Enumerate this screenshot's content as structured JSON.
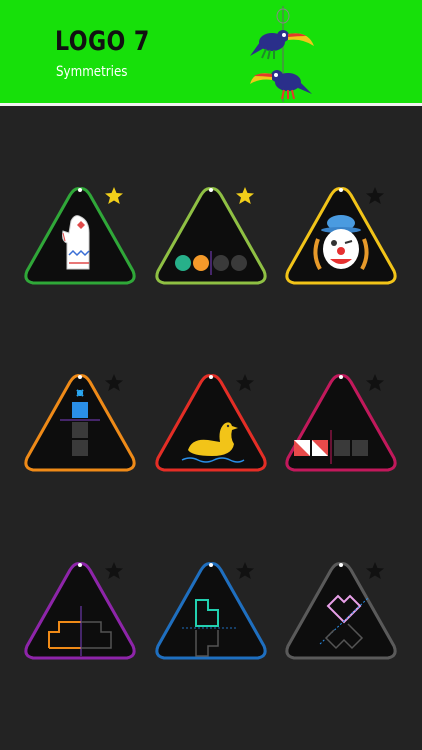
{
  "header": {
    "title": "LOGO 7",
    "subtitle": "Symmetries",
    "background_color": "#17e00a",
    "mascot_icon": "toucans-icon"
  },
  "levels": [
    {
      "name": "mitten",
      "color": "#2fa838",
      "starred": true
    },
    {
      "name": "dots",
      "color": "#8fc043",
      "starred": true
    },
    {
      "name": "clown",
      "color": "#f2c418",
      "starred": false
    },
    {
      "name": "stack",
      "color": "#ef8a17",
      "starred": false
    },
    {
      "name": "duck",
      "color": "#e52d25",
      "starred": false
    },
    {
      "name": "squares",
      "color": "#c2185b",
      "starred": false
    },
    {
      "name": "orange-shape",
      "color": "#8e24aa",
      "starred": false
    },
    {
      "name": "teal-shape",
      "color": "#1e6fc0",
      "starred": false
    },
    {
      "name": "heart-shape",
      "color": "#5a5a5a",
      "starred": false
    }
  ],
  "colors": {
    "star_on": "#f2cf1a",
    "star_off": "#111111",
    "triangle_fill": "#0d0d0d",
    "triangle_stroke": "#444444"
  }
}
